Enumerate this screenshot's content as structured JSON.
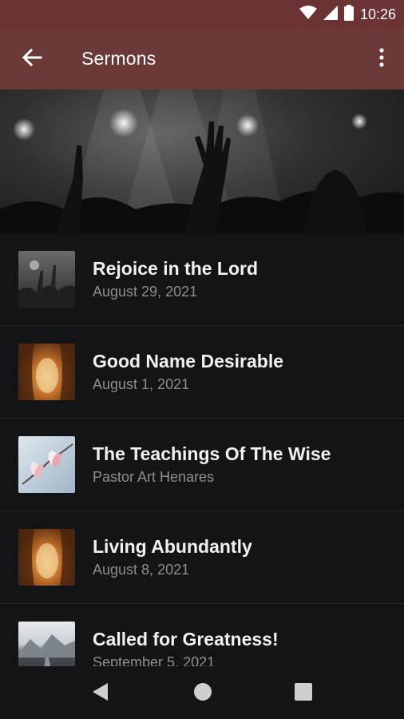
{
  "status_bar": {
    "time": "10:26",
    "icons": [
      "wifi-icon",
      "signal-icon",
      "battery-icon"
    ]
  },
  "app_bar": {
    "title": "Sermons",
    "back_icon": "arrow-back-icon",
    "menu_icon": "more-vert-icon",
    "color": "#6b3a38"
  },
  "hero": {
    "image": "worship-concert-hands-raised"
  },
  "sermons": [
    {
      "title": "Rejoice in the Lord",
      "subtitle": "August 29, 2021",
      "thumb": "hands-raised"
    },
    {
      "title": "Good Name Desirable",
      "subtitle": "August 1, 2021",
      "thumb": "empty-tomb"
    },
    {
      "title": "The Teachings Of The Wise",
      "subtitle": "Pastor Art Henares",
      "thumb": "magnolia-flowers"
    },
    {
      "title": "Living Abundantly",
      "subtitle": "August 8, 2021",
      "thumb": "empty-tomb"
    },
    {
      "title": "Called for Greatness!",
      "subtitle": "September 5, 2021",
      "thumb": "mountain-road"
    }
  ],
  "nav_bar": {
    "icons": [
      "back-triangle-icon",
      "home-circle-icon",
      "recents-square-icon"
    ]
  },
  "colors": {
    "background": "#131416",
    "title_text": "#f1f1f1",
    "subtitle_text": "#8d8f93",
    "divider": "#24262a"
  }
}
